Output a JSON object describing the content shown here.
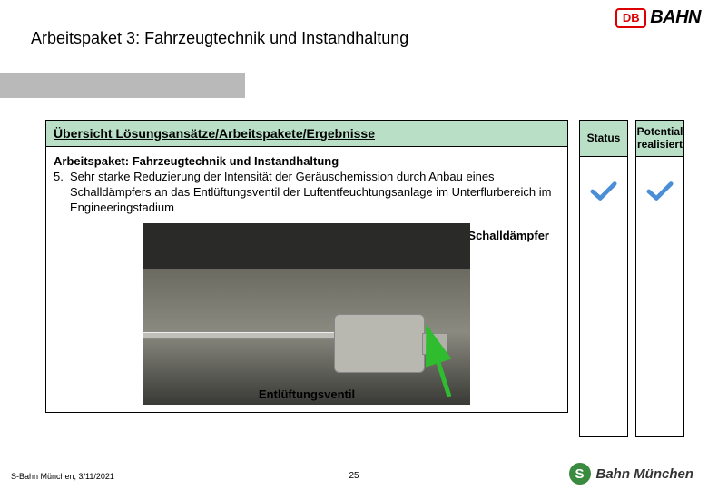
{
  "header": {
    "title": "Arbeitspaket 3: Fahrzeugtechnik und Instandhaltung",
    "logo": {
      "db": "DB",
      "bahn": "BAHN"
    }
  },
  "main": {
    "header_label": "Übersicht Lösungsansätze/Arbeitspakete/Ergebnisse",
    "workpackage_title": "Arbeitspaket: Fahrzeugtechnik und Instandhaltung",
    "item_number": "5.",
    "item_text": "Sehr starke Reduzierung der Intensität der Geräuschemission durch Anbau eines Schalldämpfers an das Entlüftungsventil der Luftentfeuchtungsanlage im Unterflurbereich im Engineeringstadium",
    "label_top": "Schalldämpfer",
    "label_bottom": "Entlüftungsventil"
  },
  "status": {
    "header": "Status"
  },
  "potential": {
    "header": "Potential realisiert"
  },
  "footer": {
    "left": "S-Bahn München, 3/11/2021",
    "page": "25",
    "sbahn_logo": {
      "s": "S",
      "text": "Bahn München"
    }
  }
}
